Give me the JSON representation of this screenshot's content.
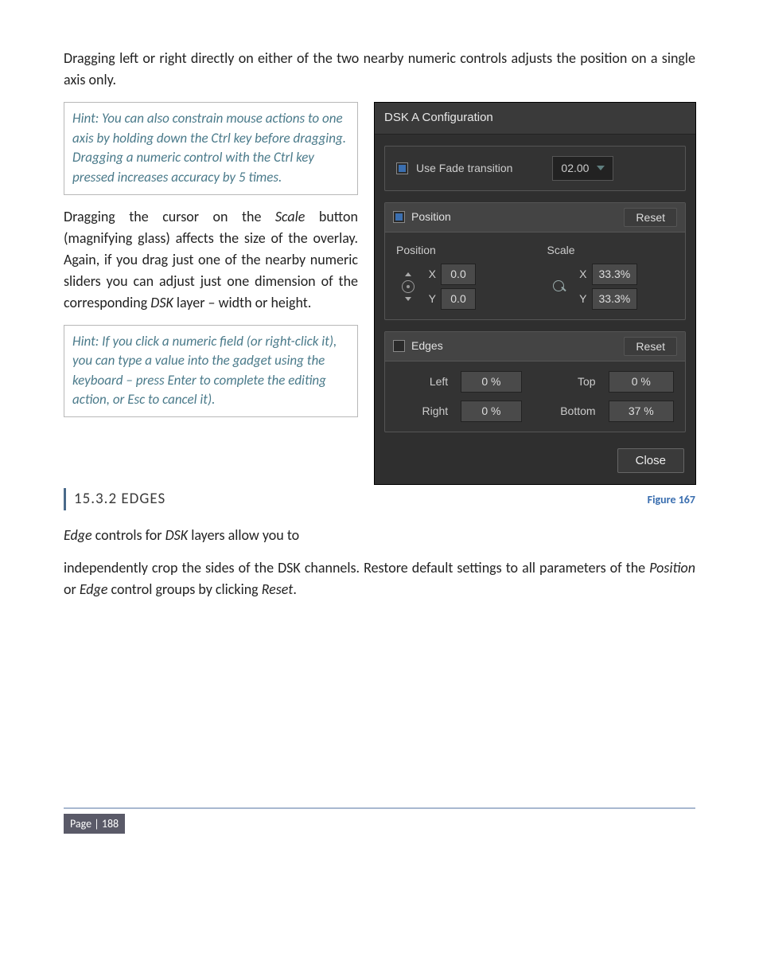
{
  "intro": "Dragging left or right directly on either of the two nearby numeric controls adjusts the position on a single axis only.",
  "hint1": "Hint: You can also constrain mouse actions to one axis by holding down the Ctrl key before dragging. Dragging a numeric control with the Ctrl key pressed increases accuracy by 5 times.",
  "para2_a": "Dragging the cursor on the ",
  "para2_scale": "Scale",
  "para2_b": " button (magnifying glass) affects the size of the overlay.  Again, if you drag just one of the nearby numeric sliders you can adjust just one dimension of the corresponding ",
  "para2_dsk": "DSK",
  "para2_c": " layer – width or height.",
  "hint2": "Hint: If you click a numeric field (or right-click it), you can type a value into the gadget using the keyboard – press Enter to complete the editing action, or Esc to cancel it).",
  "section_heading": "15.3.2 EDGES",
  "figure_label": "Figure 167",
  "para3_a": "Edge",
  "para3_b": " controls for ",
  "para3_c": "DSK",
  "para3_d": " layers allow you to",
  "para4_a": "independently crop the sides of the DSK channels. Restore default settings to all parameters of the ",
  "para4_pos": "Position",
  "para4_b": " or ",
  "para4_edge": "Edge",
  "para4_c": " control groups by clicking ",
  "para4_reset": "Reset",
  "para4_d": ".",
  "page_num": "Page | 188",
  "dlg": {
    "title": "DSK A Configuration",
    "fade_label": "Use Fade transition",
    "fade_duration": "02.00",
    "position_hdr": "Position",
    "reset": "Reset",
    "pos_lbl": "Position",
    "scale_lbl": "Scale",
    "x": "X",
    "y": "Y",
    "pos_x": "0.0",
    "pos_y": "0.0",
    "scale_x": "33.3%",
    "scale_y": "33.3%",
    "edges_hdr": "Edges",
    "left": "Left",
    "right": "Right",
    "top": "Top",
    "bottom": "Bottom",
    "left_v": "0 %",
    "right_v": "0 %",
    "top_v": "0 %",
    "bottom_v": "37 %",
    "close": "Close"
  }
}
